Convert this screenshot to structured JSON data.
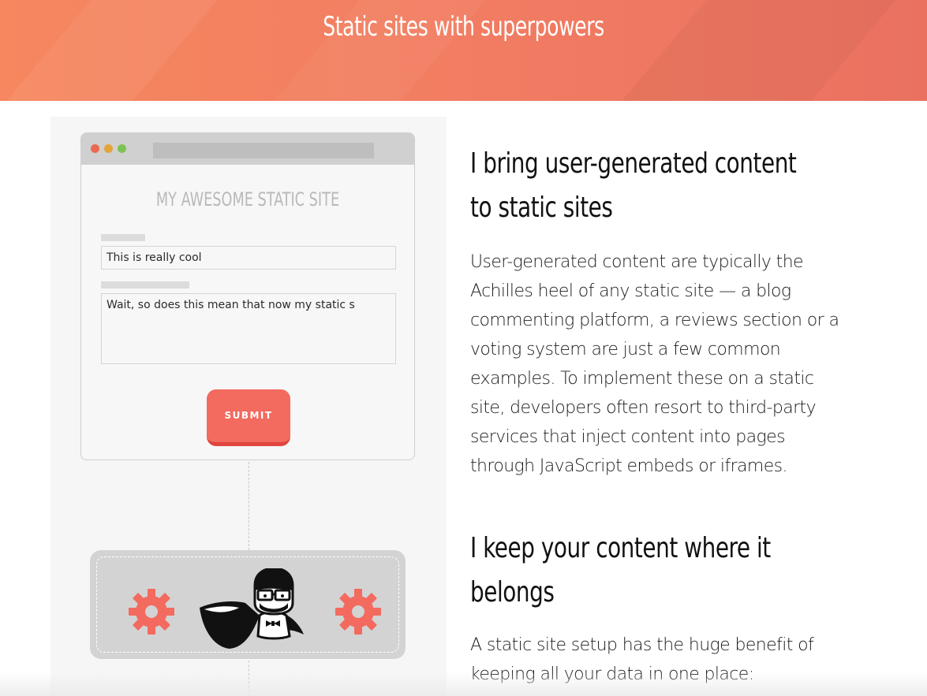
{
  "banner": {
    "title": "Static sites with superpowers"
  },
  "illustration": {
    "site_title": "MY AWESOME STATIC SITE",
    "name_field_value": "This is really cool",
    "comment_field_value": "Wait, so does this mean that now my static s",
    "submit_label": "SUBMIT",
    "icons": [
      "gear-icon",
      "mascot-icon"
    ]
  },
  "content": {
    "heading_1": "I bring user-generated content to static sites",
    "paragraph_1": "User-generated content are typically the Achilles heel of any static site — a blog commenting platform, a reviews section or a voting system are just a few common examples. To implement these on a static site, developers often resort to third-party services that inject content into pages through JavaScript embeds or iframes.",
    "heading_2": "I keep your content where it belongs",
    "paragraph_2": "A static site setup has the huge benefit of keeping all your data in one place:"
  },
  "colors": {
    "banner_start": "#f6875f",
    "banner_end": "#ea7160",
    "accent": "#f36a5e",
    "gear": "#f36a5e"
  }
}
